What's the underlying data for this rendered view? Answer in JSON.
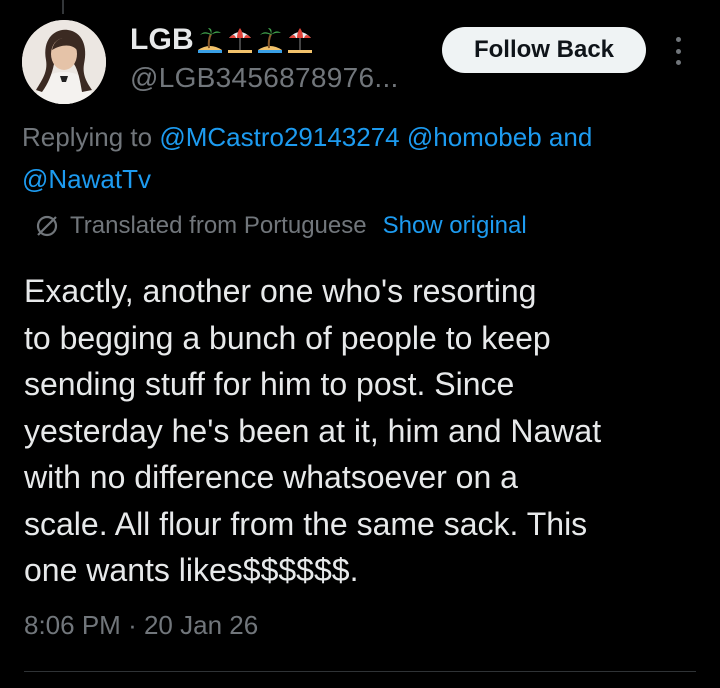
{
  "tweet": {
    "author": {
      "display_name": "LGB",
      "name_emojis": [
        "desert-island-emoji",
        "beach-umbrella-emoji",
        "desert-island-emoji",
        "beach-umbrella-emoji"
      ],
      "handle": "@LGB3456878976..."
    },
    "follow_label": "Follow Back",
    "replying": {
      "prefix": "Replying to",
      "mention_1": "@MCastro29143274",
      "mention_2": "@homobeb",
      "joiner": "and",
      "mention_3": "@NawatTv"
    },
    "translation": {
      "icon": "globe-icon",
      "label": "Translated from Portuguese",
      "show_original": "Show original"
    },
    "text": "Exactly, another one who's resorting\nto begging a bunch of people to keep\nsending stuff for him to post. Since\nyesterday he's been at it, him and Nawat\nwith no difference whatsoever on a\nscale. All flour from the same sack. This\none wants likes$$$$$$.",
    "time": "8:06 PM",
    "separator": "·",
    "date": "20 Jan 26"
  },
  "colors": {
    "background": "#000000",
    "primary_text": "#e7e9ea",
    "secondary_text": "#71767b",
    "link": "#1d9bf0",
    "button_bg": "#eff3f4"
  }
}
